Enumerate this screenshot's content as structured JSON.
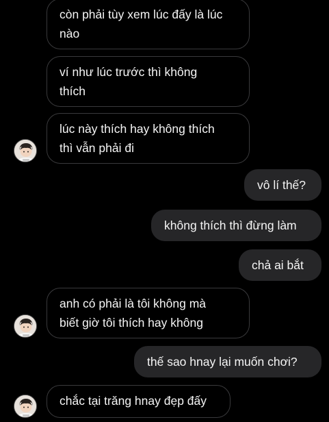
{
  "messages": [
    {
      "side": "in",
      "text": "còn phải tùy xem lúc đấy là lúc\nnào"
    },
    {
      "side": "in",
      "text": "ví như lúc trước thì không\nthích"
    },
    {
      "side": "in",
      "text": "lúc này thích hay không thích\nthì vẫn phải đi"
    },
    {
      "side": "out",
      "text": "vô lí thế?"
    },
    {
      "side": "out",
      "text": "không thích thì đừng làm"
    },
    {
      "side": "out",
      "text": "chả ai bắt"
    },
    {
      "side": "in",
      "text": "anh có phải là tôi không mà\nbiết giờ tôi thích hay không"
    },
    {
      "side": "out",
      "text": "thế sao hnay lại muốn chơi?"
    },
    {
      "side": "in",
      "text": "chắc tại trăng hnay đẹp đấy"
    }
  ],
  "avatar": {
    "icon": "contact-avatar-icon"
  },
  "colors": {
    "background": "#000000",
    "incoming_border": "#3a3a3c",
    "outgoing_fill": "#262628",
    "text": "#f5f5f5"
  }
}
